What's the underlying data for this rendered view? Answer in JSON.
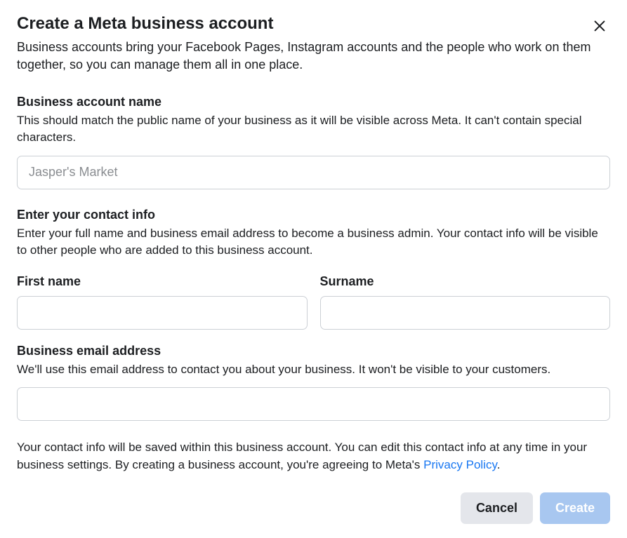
{
  "header": {
    "title": "Create a Meta business account",
    "subtitle": "Business accounts bring your Facebook Pages, Instagram accounts and the people who work on them together, so you can manage them all in one place."
  },
  "businessName": {
    "label": "Business account name",
    "help": "This should match the public name of your business as it will be visible across Meta. It can't contain special characters.",
    "placeholder": "Jasper's Market",
    "value": ""
  },
  "contactInfo": {
    "label": "Enter your contact info",
    "help": "Enter your full name and business email address to become a business admin. Your contact info will be visible to other people who are added to this business account."
  },
  "firstName": {
    "label": "First name",
    "value": ""
  },
  "surname": {
    "label": "Surname",
    "value": ""
  },
  "email": {
    "label": "Business email address",
    "help": "We'll use this email address to contact you about your business. It won't be visible to your customers.",
    "value": ""
  },
  "disclaimer": {
    "textBeforeLink": "Your contact info will be saved within this business account. You can edit this contact info at any time in your business settings. By creating a business account, you're agreeing to Meta's ",
    "linkText": "Privacy Policy",
    "textAfterLink": "."
  },
  "footer": {
    "cancel": "Cancel",
    "create": "Create"
  }
}
